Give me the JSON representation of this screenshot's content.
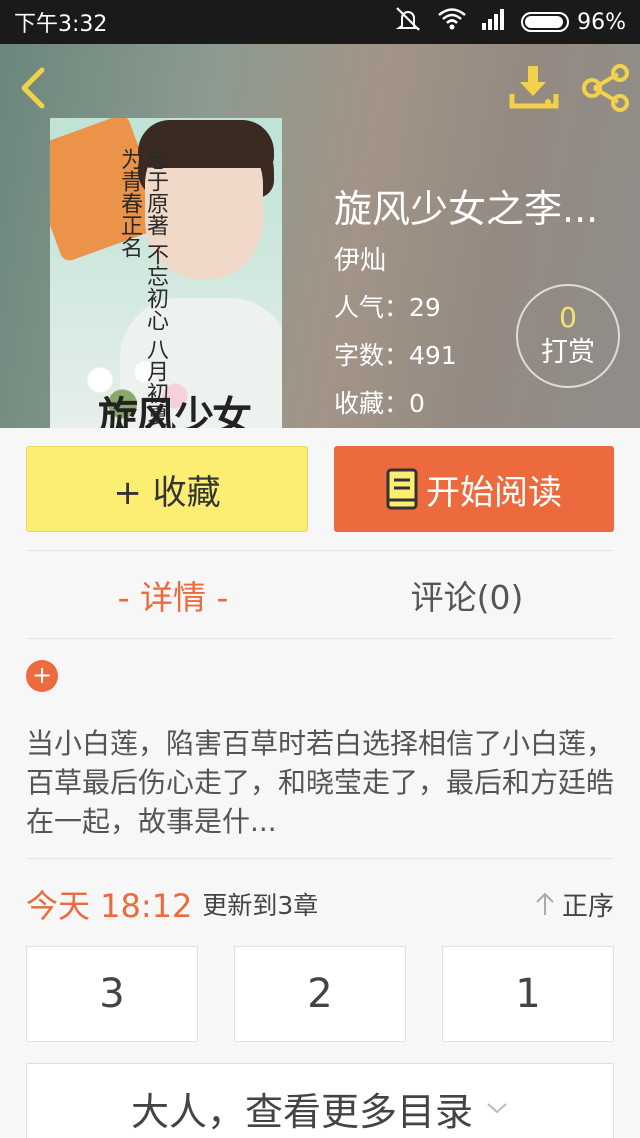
{
  "status_bar": {
    "time": "下午3:32",
    "battery": "96%",
    "battery_level": 0.96
  },
  "header": {
    "back_icon": "chevron-left-icon",
    "download_icon": "download-icon",
    "share_icon": "share-icon"
  },
  "book": {
    "cover_text": "忠于原著 不忘初心 八月初夏 为青春正名",
    "cover_title": "旋风少女",
    "title": "旋风少女之李...",
    "author": "伊灿",
    "popularity": "人气：29",
    "word_count": "字数：491",
    "favorites": "收藏：0"
  },
  "reward": {
    "count": "0",
    "label": "打赏"
  },
  "actions": {
    "collect_label": "+ 收藏",
    "read_label": "开始阅读",
    "read_icon": "book-icon"
  },
  "tabs": [
    {
      "label": "- 详情 -"
    },
    {
      "label": "评论(0)"
    }
  ],
  "detail": {
    "expand_label": "+",
    "summary": "当小白莲，陷害百草时若白选择相信了小白莲，百草最后伤心走了，和晓莹走了，最后和方廷皓在一起，故事是什..."
  },
  "updates": {
    "time": "今天 18:12",
    "text": "更新到3章",
    "sort_label": "正序",
    "sort_icon": "arrow-up-icon"
  },
  "chapters": [
    {
      "label": "3"
    },
    {
      "label": "2"
    },
    {
      "label": "1"
    }
  ],
  "more_catalog": {
    "label": "大人，查看更多目录",
    "icon": "chevron-down-icon"
  },
  "colors": {
    "accent": "#ec6a3e",
    "collect_bg": "#fbee72",
    "reward_count": "#f5e36c"
  }
}
